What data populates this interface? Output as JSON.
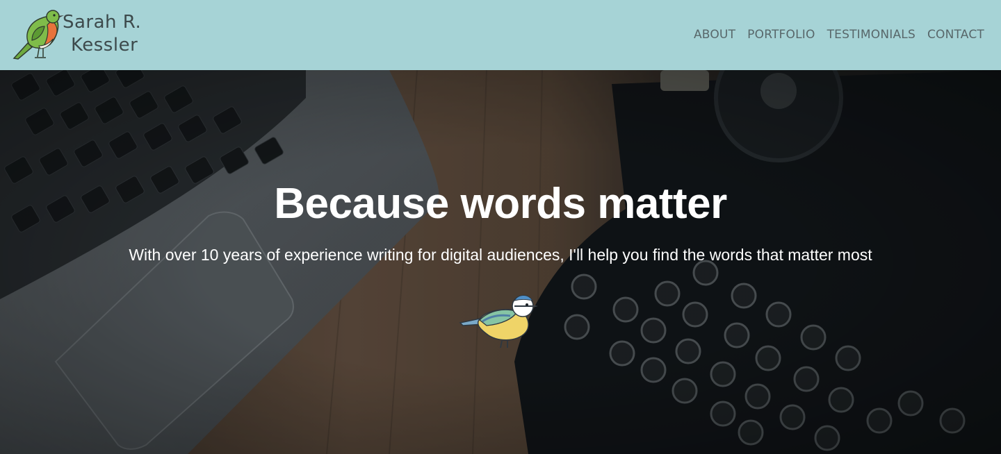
{
  "site": {
    "logo_line1": "Sarah R.",
    "logo_line2": "Kessler",
    "logo_icon": "robin-icon"
  },
  "nav": {
    "items": [
      {
        "label": "ABOUT"
      },
      {
        "label": "PORTFOLIO"
      },
      {
        "label": "TESTIMONIALS"
      },
      {
        "label": "CONTACT"
      }
    ]
  },
  "hero": {
    "title": "Because words matter",
    "subtitle": "With over 10 years of experience writing for digital audiences, I'll help you find the words that matter most",
    "bird_icon": "blue-tit-icon"
  },
  "colors": {
    "header_bg": "#a6d3d6",
    "nav_text": "#58676a",
    "logo_text": "#3d4a4c",
    "hero_text": "#ffffff"
  }
}
